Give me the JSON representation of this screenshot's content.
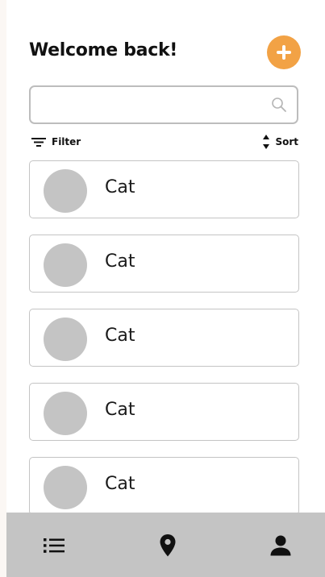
{
  "header": {
    "title": "Welcome back!",
    "add_icon": "plus-icon",
    "accent_color": "#f2a245"
  },
  "search": {
    "value": "",
    "placeholder": "",
    "icon": "search-icon"
  },
  "controls": {
    "filter_label": "Filter",
    "sort_label": "Sort"
  },
  "cards": [
    {
      "label": "Cat"
    },
    {
      "label": "Cat"
    },
    {
      "label": "Cat"
    },
    {
      "label": "Cat"
    },
    {
      "label": "Cat"
    }
  ],
  "bottom_nav": {
    "items": [
      {
        "icon": "list-icon"
      },
      {
        "icon": "location-pin-icon"
      },
      {
        "icon": "person-icon"
      }
    ],
    "background": "#c4c4c4"
  }
}
